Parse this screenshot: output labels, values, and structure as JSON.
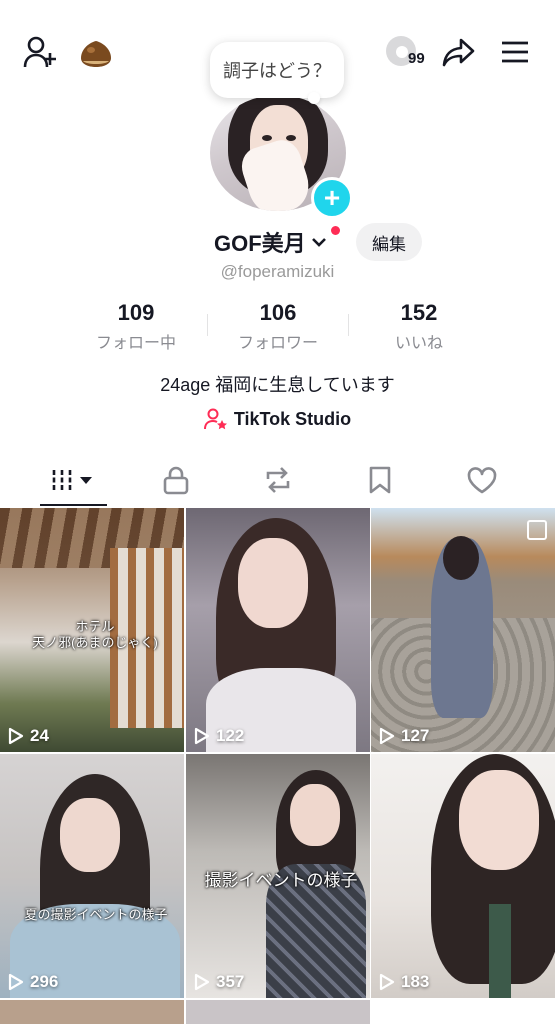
{
  "header": {
    "add_friend_icon": "person-plus-icon",
    "chestnut_icon": "chestnut-icon",
    "coin_badge": "99",
    "share_icon": "share-arrow-icon",
    "menu_icon": "hamburger-menu-icon"
  },
  "profile": {
    "status_text": "調子はどう？",
    "name": "GOF美月",
    "edit_label": "編集",
    "handle": "@foperamizuki",
    "bio": "24age 福岡に生息しています",
    "studio_label": "TikTok Studio"
  },
  "stats": [
    {
      "num": "109",
      "label": "フォロー中"
    },
    {
      "num": "106",
      "label": "フォロワー"
    },
    {
      "num": "152",
      "label": "いいね"
    }
  ],
  "tabs": [
    "videos-grid-icon",
    "lock-icon",
    "repost-icon",
    "bookmark-icon",
    "heart-icon"
  ],
  "videos": [
    {
      "views": "24",
      "caption1": "ホテル",
      "caption2": "天ノ邪(あまのじゃく)"
    },
    {
      "views": "122"
    },
    {
      "views": "127"
    },
    {
      "views": "296",
      "caption1": "夏の撮影イベントの様子"
    },
    {
      "views": "357",
      "caption1": "撮影イベントの様子"
    },
    {
      "views": "183"
    }
  ],
  "colors": {
    "accent": "#fe2c55",
    "plus": "#20d5ec"
  }
}
